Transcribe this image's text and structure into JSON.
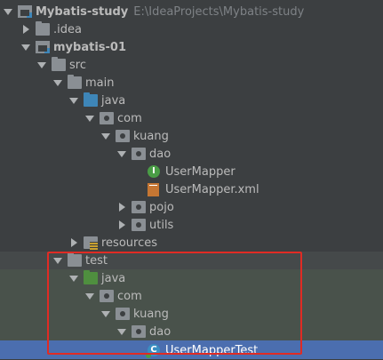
{
  "project": {
    "name": "Mybatis-study",
    "path": "E:\\IdeaProjects\\Mybatis-study"
  },
  "tree": [
    {
      "label": "Mybatis-study",
      "icon": "module-folder-icon",
      "depth": 0,
      "expanded": true,
      "bold": true
    },
    {
      "label": ".idea",
      "icon": "folder-icon",
      "depth": 1,
      "expanded": false
    },
    {
      "label": "mybatis-01",
      "icon": "module-folder-icon",
      "depth": 1,
      "expanded": true,
      "bold": true
    },
    {
      "label": "src",
      "icon": "folder-icon",
      "depth": 2,
      "expanded": true
    },
    {
      "label": "main",
      "icon": "folder-icon",
      "depth": 3,
      "expanded": true
    },
    {
      "label": "java",
      "icon": "source-folder-icon",
      "depth": 4,
      "expanded": true
    },
    {
      "label": "com",
      "icon": "package-icon",
      "depth": 5,
      "expanded": true
    },
    {
      "label": "kuang",
      "icon": "package-icon",
      "depth": 6,
      "expanded": true
    },
    {
      "label": "dao",
      "icon": "package-icon",
      "depth": 7,
      "expanded": true
    },
    {
      "label": "UserMapper",
      "icon": "interface-icon",
      "depth": 8
    },
    {
      "label": "UserMapper.xml",
      "icon": "xml-file-icon",
      "depth": 8
    },
    {
      "label": "pojo",
      "icon": "package-icon",
      "depth": 7,
      "expanded": false
    },
    {
      "label": "utils",
      "icon": "package-icon",
      "depth": 7,
      "expanded": false
    },
    {
      "label": "resources",
      "icon": "resources-folder-icon",
      "depth": 4,
      "expanded": false
    },
    {
      "label": "test",
      "icon": "folder-icon",
      "depth": 3,
      "expanded": true
    },
    {
      "label": "java",
      "icon": "test-source-folder-icon",
      "depth": 4,
      "expanded": true
    },
    {
      "label": "com",
      "icon": "package-icon",
      "depth": 5,
      "expanded": true
    },
    {
      "label": "kuang",
      "icon": "package-icon",
      "depth": 6,
      "expanded": true
    },
    {
      "label": "dao",
      "icon": "package-icon",
      "depth": 7,
      "expanded": true
    },
    {
      "label": "UserMapperTest",
      "icon": "test-class-icon",
      "depth": 8,
      "selected": true
    }
  ],
  "colors": {
    "background": "#3c3f41",
    "selection": "#4b6eaf",
    "test_area": "#49524b",
    "highlight_border": "#e02b24"
  }
}
